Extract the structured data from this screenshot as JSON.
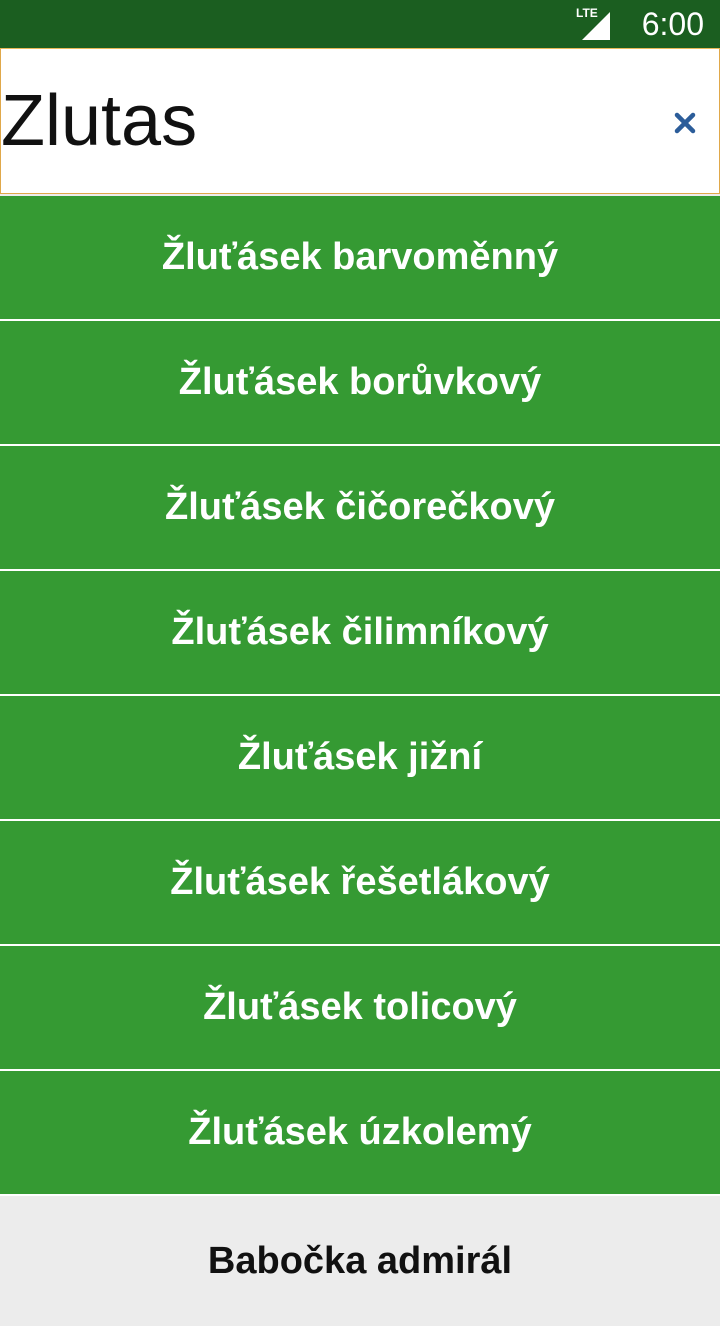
{
  "status_bar": {
    "network_label": "LTE",
    "time": "6:00",
    "icon": "signal-icon"
  },
  "search": {
    "value": "Zlutas",
    "clear_icon": "close-icon",
    "accent_color": "#e0a84a"
  },
  "results": [
    {
      "label": "Žluťásek barvoměnný"
    },
    {
      "label": "Žluťásek borůvkový"
    },
    {
      "label": "Žluťásek čičorečkový"
    },
    {
      "label": "Žluťásek čilimníkový"
    },
    {
      "label": "Žluťásek jižní"
    },
    {
      "label": "Žluťásek řešetlákový"
    },
    {
      "label": "Žluťásek tolicový"
    },
    {
      "label": "Žluťásek úzkolemý"
    }
  ],
  "other_results": [
    {
      "label": "Babočka admirál"
    }
  ],
  "colors": {
    "status_bar_bg": "#1b5e20",
    "match_bg": "#359a33",
    "other_bg": "#ececec"
  }
}
